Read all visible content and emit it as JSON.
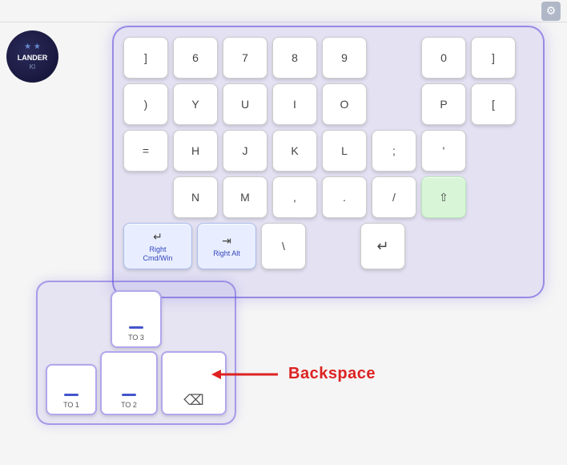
{
  "topbar": {
    "gear_label": "⚙"
  },
  "avatar": {
    "subtitle": "★  ★",
    "title": "LANDER",
    "sub2": "KI"
  },
  "keyboard": {
    "rows": [
      [
        {
          "label": "]",
          "size": "sm"
        },
        {
          "label": "6",
          "size": "sm"
        },
        {
          "label": "7",
          "size": "sm"
        },
        {
          "label": "8",
          "size": "sm"
        },
        {
          "label": "9",
          "size": "sm"
        },
        {
          "label": "",
          "size": "sm",
          "empty": true
        },
        {
          "label": "0",
          "size": "sm"
        },
        {
          "label": "]",
          "size": "sm"
        }
      ],
      [
        {
          "label": ")",
          "size": "sm"
        },
        {
          "label": "Y",
          "size": "sm"
        },
        {
          "label": "U",
          "size": "sm"
        },
        {
          "label": "I",
          "size": "sm"
        },
        {
          "label": "O",
          "size": "sm"
        },
        {
          "label": "",
          "size": "sm",
          "empty": true
        },
        {
          "label": "P",
          "size": "sm"
        },
        {
          "label": "[",
          "size": "sm"
        }
      ],
      [
        {
          "label": "=",
          "size": "sm"
        },
        {
          "label": "H",
          "size": "sm"
        },
        {
          "label": "J",
          "size": "sm"
        },
        {
          "label": "K",
          "size": "sm"
        },
        {
          "label": "L",
          "size": "sm"
        },
        {
          "label": ";",
          "size": "sm"
        },
        {
          "label": "'",
          "size": "sm"
        }
      ],
      [
        {
          "label": "",
          "size": "sm",
          "empty": true
        },
        {
          "label": "N",
          "size": "sm"
        },
        {
          "label": "M",
          "size": "sm"
        },
        {
          "label": ",",
          "size": "sm"
        },
        {
          "label": ".",
          "size": "sm"
        },
        {
          "label": "/",
          "size": "sm"
        },
        {
          "label": "⇧",
          "size": "sm",
          "variant": "shift"
        }
      ],
      [
        {
          "label": "Right\nCmd/Win",
          "size": "md",
          "icon": "↵",
          "variant": "blue"
        },
        {
          "label": "Right Alt",
          "size": "md",
          "icon": "⇥",
          "variant": "blue"
        },
        {
          "label": "\\",
          "size": "sm"
        },
        {
          "label": "",
          "size": "sm",
          "empty": true
        },
        {
          "label": "↵",
          "size": "sm",
          "enter": true
        }
      ]
    ]
  },
  "secondary": {
    "to3_label": "TO 3",
    "to1_label": "TO 1",
    "to2_label": "TO 2",
    "bs_label": "Backspace"
  },
  "arrow": {
    "label": "Backspace"
  }
}
